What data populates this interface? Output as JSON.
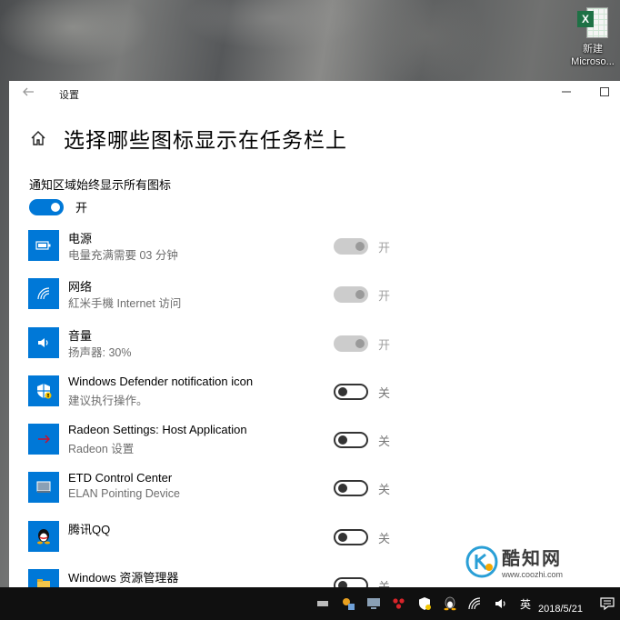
{
  "desktop": {
    "icon_label_line1": "新建",
    "icon_label_line2": "Microso..."
  },
  "window": {
    "title": "设置",
    "page_title": "选择哪些图标显示在任务栏上",
    "always_show_label": "通知区域始终显示所有图标",
    "always_show_state": "开",
    "apps": [
      {
        "name": "电源",
        "sub": "电量充满需要 03 分钟",
        "state": "开",
        "toggle": "disabled",
        "icon": "battery-icon"
      },
      {
        "name": "网络",
        "sub": "紅米手機 Internet 访问",
        "state": "开",
        "toggle": "disabled",
        "icon": "wifi-icon"
      },
      {
        "name": "音量",
        "sub": "扬声器: 30%",
        "state": "开",
        "toggle": "disabled",
        "icon": "speaker-icon"
      },
      {
        "name": "Windows Defender notification icon",
        "sub": "建议执行操作。",
        "state": "关",
        "toggle": "off",
        "icon": "defender-shield-icon"
      },
      {
        "name": "Radeon Settings: Host Application",
        "sub": "Radeon 设置",
        "state": "关",
        "toggle": "off",
        "icon": "radeon-icon"
      },
      {
        "name": "ETD Control Center",
        "sub": "ELAN Pointing Device",
        "state": "关",
        "toggle": "off",
        "icon": "touchpad-icon"
      },
      {
        "name": "腾讯QQ",
        "sub": "",
        "state": "关",
        "toggle": "off",
        "icon": "qq-penguin-icon"
      },
      {
        "name": "Windows 资源管理器",
        "sub": "",
        "state": "关",
        "toggle": "off",
        "icon": "explorer-icon"
      }
    ]
  },
  "watermark": {
    "title": "酷知网",
    "url": "www.coozhi.com"
  },
  "taskbar": {
    "ime": "英",
    "date": "2018/5/21"
  },
  "colors": {
    "accent": "#0078d7",
    "taskbar": "#101010",
    "window_bg": "#ffffff"
  }
}
